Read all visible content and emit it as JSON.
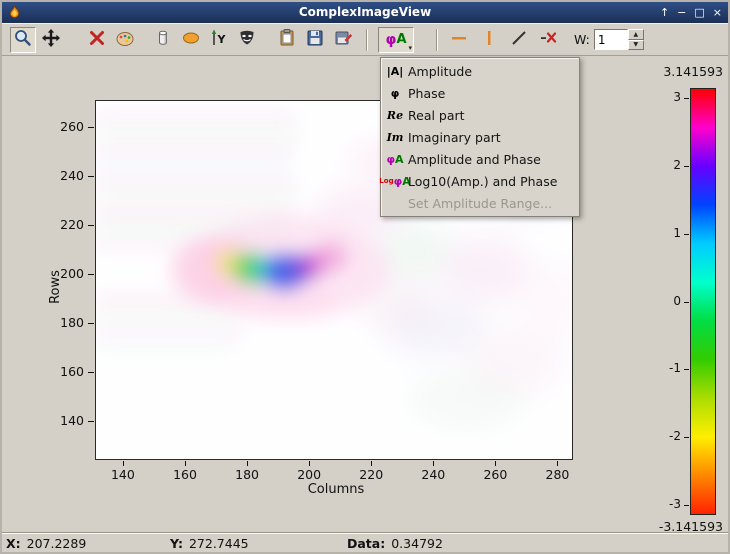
{
  "window": {
    "title": "ComplexImageView",
    "controls": [
      {
        "name": "shade",
        "glyph": "↑"
      },
      {
        "name": "minimize",
        "glyph": "−"
      },
      {
        "name": "maximize",
        "glyph": "□"
      },
      {
        "name": "close",
        "glyph": "×"
      }
    ]
  },
  "toolbar": {
    "icons": [
      "zoom",
      "pan",
      "delete",
      "palette",
      "colormap",
      "ellipse-roi",
      "axes-settings",
      "mask",
      "copy-to-clipboard",
      "save",
      "save-as",
      "display-mode",
      "horizontal-cut",
      "vertical-cut",
      "diagonal-cut",
      "delete-cuts"
    ],
    "phi_a": {
      "phi": "φ",
      "a": "A",
      "arrow": "▾"
    },
    "w_label": "W:",
    "w_value": "1",
    "spin_up": "▲",
    "spin_down": "▼"
  },
  "menu": {
    "items": [
      {
        "label": "Amplitude",
        "enabled": true,
        "icon_parts": [
          {
            "text": "|A|",
            "color": "#000000"
          }
        ]
      },
      {
        "label": "Phase",
        "enabled": true,
        "icon_parts": [
          {
            "text": "φ",
            "color": "#000000"
          }
        ]
      },
      {
        "label": "Real part",
        "enabled": true,
        "icon_parts": [
          {
            "text": "Re",
            "color": "#000000",
            "serif": true
          }
        ]
      },
      {
        "label": "Imaginary part",
        "enabled": true,
        "icon_parts": [
          {
            "text": "Im",
            "color": "#000000",
            "serif": true
          }
        ]
      },
      {
        "label": "Amplitude and Phase",
        "enabled": true,
        "icon_parts": [
          {
            "text": "φ",
            "color": "#b000b0"
          },
          {
            "text": "A",
            "color": "#007700"
          }
        ]
      },
      {
        "label": "Log10(Amp.) and Phase",
        "enabled": true,
        "icon_parts": [
          {
            "text": "Log",
            "color": "#cc0000",
            "small": true
          },
          {
            "text": "φ",
            "color": "#b000b0"
          },
          {
            "text": "A",
            "color": "#007700"
          }
        ]
      },
      {
        "label": "Set Amplitude Range...",
        "enabled": false,
        "icon_parts": []
      }
    ]
  },
  "chart_data": {
    "type": "heatmap",
    "xlabel": "Columns",
    "ylabel": "Rows",
    "x_ticks": [
      140,
      160,
      180,
      200,
      220,
      240,
      260,
      280
    ],
    "y_ticks": [
      260,
      240,
      220,
      200,
      180,
      160,
      140
    ],
    "x_range": [
      131,
      285
    ],
    "y_range": [
      124,
      271
    ],
    "description": "Complex-valued image rendered as Amplitude and Phase: hue encodes phase, saturation encodes amplitude. A saturated multicolor lobe (green-cyan-blue-violet-magenta) is centered near column 200, row 200, surrounded by a pink halo and faint pastel interference ripples, mostly in the upper-left region; the rest fades to white.",
    "colorbar": {
      "top_label": "3.141593",
      "bottom_label": "-3.141593",
      "ticks": [
        3,
        2,
        1,
        0,
        -1,
        -2,
        -3
      ],
      "vmax": 3.141593,
      "vmin": -3.141593,
      "gradient": [
        "#ff0000",
        "#ff00cc",
        "#6600ff",
        "#0044ff",
        "#00ccff",
        "#00ffcc",
        "#00dd44",
        "#33cc00",
        "#aadd00",
        "#ffee00",
        "#ff8800",
        "#ff2200"
      ]
    }
  },
  "statusbar": {
    "x_label": "X:",
    "x_value": "207.2289",
    "y_label": "Y:",
    "y_value": "272.7445",
    "data_label": "Data:",
    "data_value": "0.34792"
  }
}
